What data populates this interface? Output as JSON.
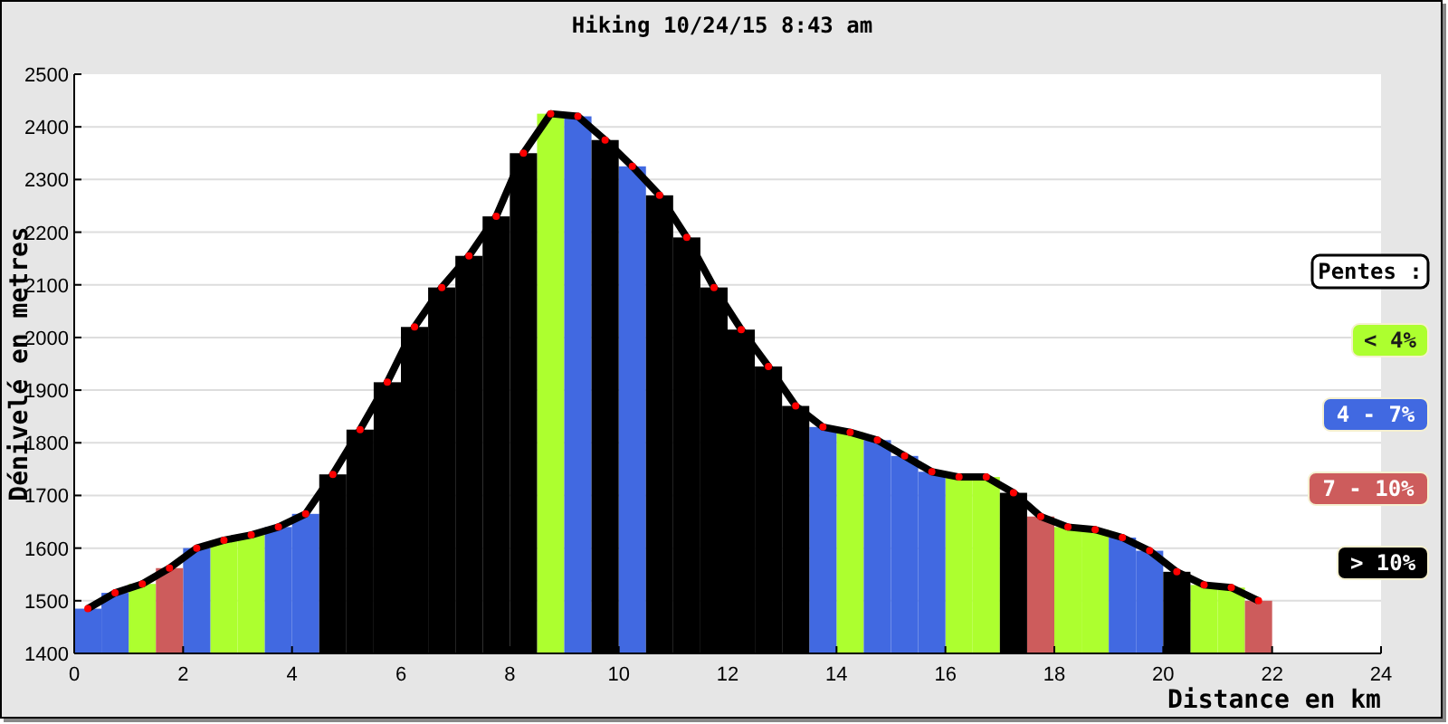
{
  "title": "Hiking 10/24/15 8:43 am",
  "legend": {
    "title": "Pentes :"
  },
  "chart_data": {
    "type": "bar",
    "grid": true,
    "xlabel": "Distance en km",
    "ylabel": "Dénivelé en metres",
    "xlim": [
      0,
      24
    ],
    "ylim": [
      1400,
      2500
    ],
    "xticks": [
      0,
      2,
      4,
      6,
      8,
      10,
      12,
      14,
      16,
      18,
      20,
      22,
      24
    ],
    "yticks": [
      1400,
      1500,
      1600,
      1700,
      1800,
      1900,
      2000,
      2100,
      2200,
      2300,
      2400,
      2500
    ],
    "x": [
      0.25,
      0.75,
      1.25,
      1.75,
      2.25,
      2.75,
      3.25,
      3.75,
      4.25,
      4.75,
      5.25,
      5.75,
      6.25,
      6.75,
      7.25,
      7.75,
      8.25,
      8.75,
      9.25,
      9.75,
      10.25,
      10.75,
      11.25,
      11.75,
      12.25,
      12.75,
      13.25,
      13.75,
      14.25,
      14.75,
      15.25,
      15.75,
      16.25,
      16.75,
      17.25,
      17.75,
      18.25,
      18.75,
      19.25,
      19.75,
      20.25,
      20.75,
      21.25,
      21.75
    ],
    "series": [
      {
        "name": "< 4%",
        "color": "#adff2f",
        "values": [
          null,
          null,
          1532,
          null,
          null,
          1615,
          1625,
          null,
          null,
          null,
          null,
          null,
          null,
          null,
          null,
          null,
          null,
          2425,
          null,
          null,
          null,
          null,
          null,
          null,
          null,
          null,
          null,
          null,
          1820,
          null,
          null,
          null,
          1735,
          1735,
          null,
          null,
          1640,
          1635,
          null,
          null,
          null,
          1530,
          1525,
          null
        ]
      },
      {
        "name": "4 - 7%",
        "color": "#4169e1",
        "values": [
          1485,
          1515,
          null,
          null,
          1600,
          null,
          null,
          1640,
          1665,
          null,
          null,
          null,
          null,
          null,
          null,
          null,
          null,
          null,
          2420,
          null,
          2325,
          null,
          null,
          null,
          null,
          null,
          null,
          1830,
          null,
          1805,
          1775,
          1745,
          null,
          null,
          null,
          null,
          null,
          null,
          1620,
          1595,
          null,
          null,
          null,
          null
        ]
      },
      {
        "name": "7 - 10%",
        "color": "#cd5c5c",
        "values": [
          null,
          null,
          null,
          1562,
          null,
          null,
          null,
          null,
          null,
          null,
          null,
          null,
          null,
          null,
          null,
          null,
          null,
          null,
          null,
          null,
          null,
          null,
          null,
          null,
          null,
          null,
          null,
          null,
          null,
          null,
          null,
          null,
          null,
          null,
          null,
          1660,
          null,
          null,
          null,
          null,
          null,
          null,
          null,
          1500
        ]
      },
      {
        "name": "> 10%",
        "color": "#000000",
        "values": [
          null,
          null,
          null,
          null,
          null,
          null,
          null,
          null,
          null,
          1740,
          1825,
          1915,
          2020,
          2095,
          2155,
          2230,
          2350,
          null,
          null,
          2375,
          null,
          2270,
          2190,
          2095,
          2015,
          1945,
          1870,
          null,
          null,
          null,
          null,
          null,
          null,
          null,
          1705,
          null,
          null,
          null,
          null,
          null,
          1555,
          null,
          null,
          null
        ]
      },
      {
        "type": "line",
        "color": "#000000",
        "marker": true,
        "values": [
          1485,
          1515,
          1532,
          1562,
          1600,
          1615,
          1625,
          1640,
          1665,
          1740,
          1825,
          1915,
          2020,
          2095,
          2155,
          2230,
          2350,
          2425,
          2420,
          2375,
          2325,
          2270,
          2190,
          2095,
          2015,
          1945,
          1870,
          1830,
          1820,
          1805,
          1775,
          1745,
          1735,
          1735,
          1705,
          1660,
          1640,
          1635,
          1620,
          1595,
          1555,
          1530,
          1525,
          1500
        ]
      }
    ]
  }
}
